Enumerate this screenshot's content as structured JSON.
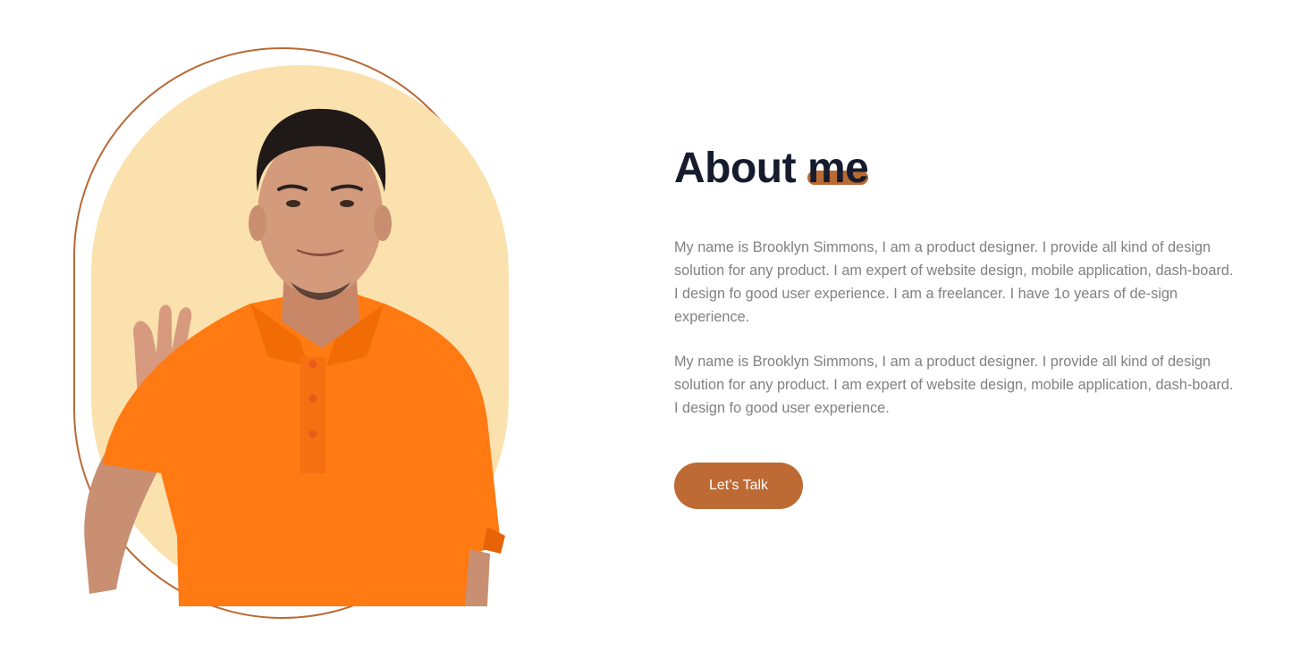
{
  "about": {
    "heading_prefix": "About",
    "heading_highlight": "me",
    "paragraphs": [
      "My name is Brooklyn Simmons, I am a product designer. I provide all kind of design solution for any product. I am expert of website design, mobile application, dash-board. I design fo good user experience. I am a freelancer. I have 1o years of de-sign experience.",
      "My name is Brooklyn Simmons, I am a product designer. I provide all kind of design solution for any product. I am expert of website design, mobile application, dash-board. I design fo good user experience."
    ],
    "cta_label": "Let’s Talk"
  },
  "colors": {
    "accent": "#bd6a34",
    "arch_fill": "#fbe1ad",
    "heading": "#161c2d",
    "body_text": "#818181",
    "shirt": "#ff7a12"
  }
}
